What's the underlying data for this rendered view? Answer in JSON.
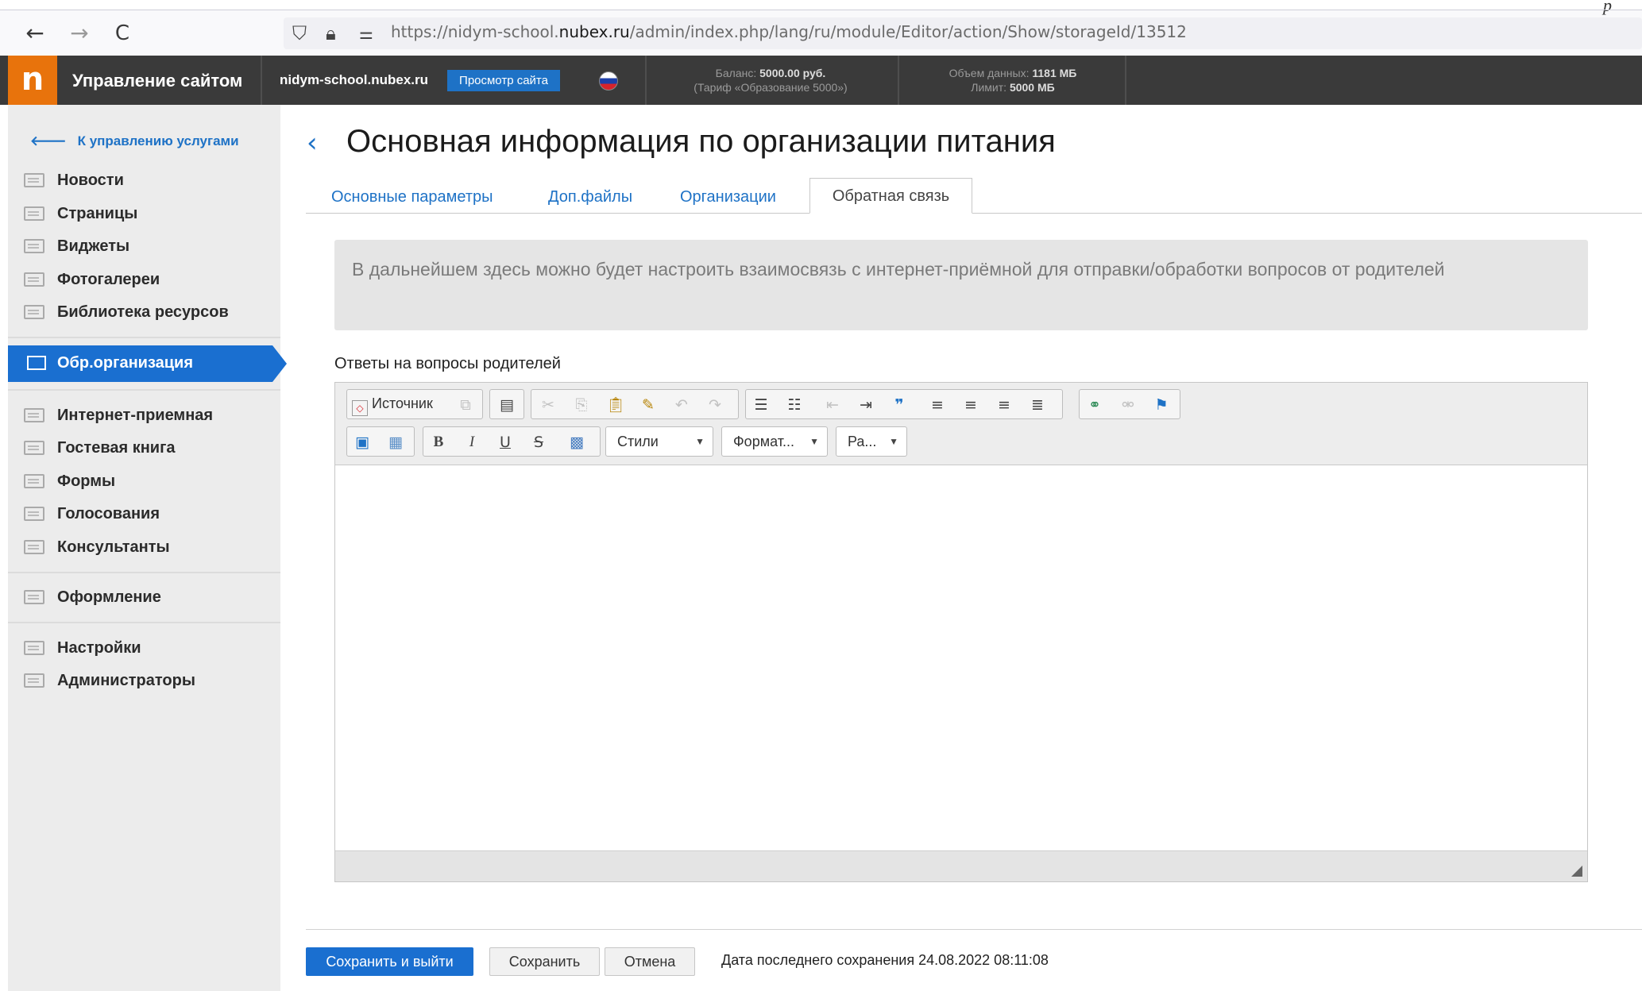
{
  "browser": {
    "url_prefix": "https://nidym-school.",
    "url_domain": "nubex.ru",
    "url_path": "/admin/index.php/lang/ru/module/Editor/action/Show/storageId/13512",
    "corner_mark": "p",
    "back": "←",
    "forward": "→",
    "reload": "C"
  },
  "admin_bar": {
    "logo": "n",
    "title": "Управление сайтом",
    "site_name": "nidym-school.nubex.ru",
    "view_site": "Просмотр сайта",
    "balance_label": "Баланс:",
    "balance_value": "5000.00 руб.",
    "tariff": "(Тариф «Образование 5000»)",
    "data_label": "Объем данных:",
    "data_value": "1181 МБ",
    "limit_label": "Лимит:",
    "limit_value": "5000 МБ"
  },
  "sidebar": {
    "back_link": "К управлению услугами",
    "group1": [
      "Новости",
      "Страницы",
      "Виджеты",
      "Фотогалереи",
      "Библиотека ресурсов"
    ],
    "active": "Обр.организация",
    "group2": [
      "Интернет-приемная",
      "Гостевая книга",
      "Формы",
      "Голосования",
      "Консультанты"
    ],
    "design": "Оформление",
    "group3": [
      "Настройки",
      "Администраторы"
    ]
  },
  "page": {
    "title": "Основная информация по организации питания",
    "tabs": [
      "Основные параметры",
      "Доп.файлы",
      "Организации",
      "Обратная связь"
    ],
    "notice": "В дальнейшем здесь можно будет настроить взаимосвязь с интернет-приёмной для отправки/обработки вопросов от родителей",
    "field_label": "Ответы на вопросы родителей"
  },
  "editor": {
    "source_label": "Источник",
    "styles": "Стили",
    "format": "Формат...",
    "size": "Ра...",
    "bold": "B",
    "italic": "I",
    "underline": "U",
    "strike": "S"
  },
  "footer": {
    "save_exit": "Сохранить и выйти",
    "save": "Сохранить",
    "cancel": "Отмена",
    "last_saved": "Дата последнего сохранения 24.08.2022 08:11:08"
  },
  "colors": {
    "accent": "#1a6fd0",
    "logo": "#e8730c",
    "admin_bar": "#3a3a3a"
  }
}
